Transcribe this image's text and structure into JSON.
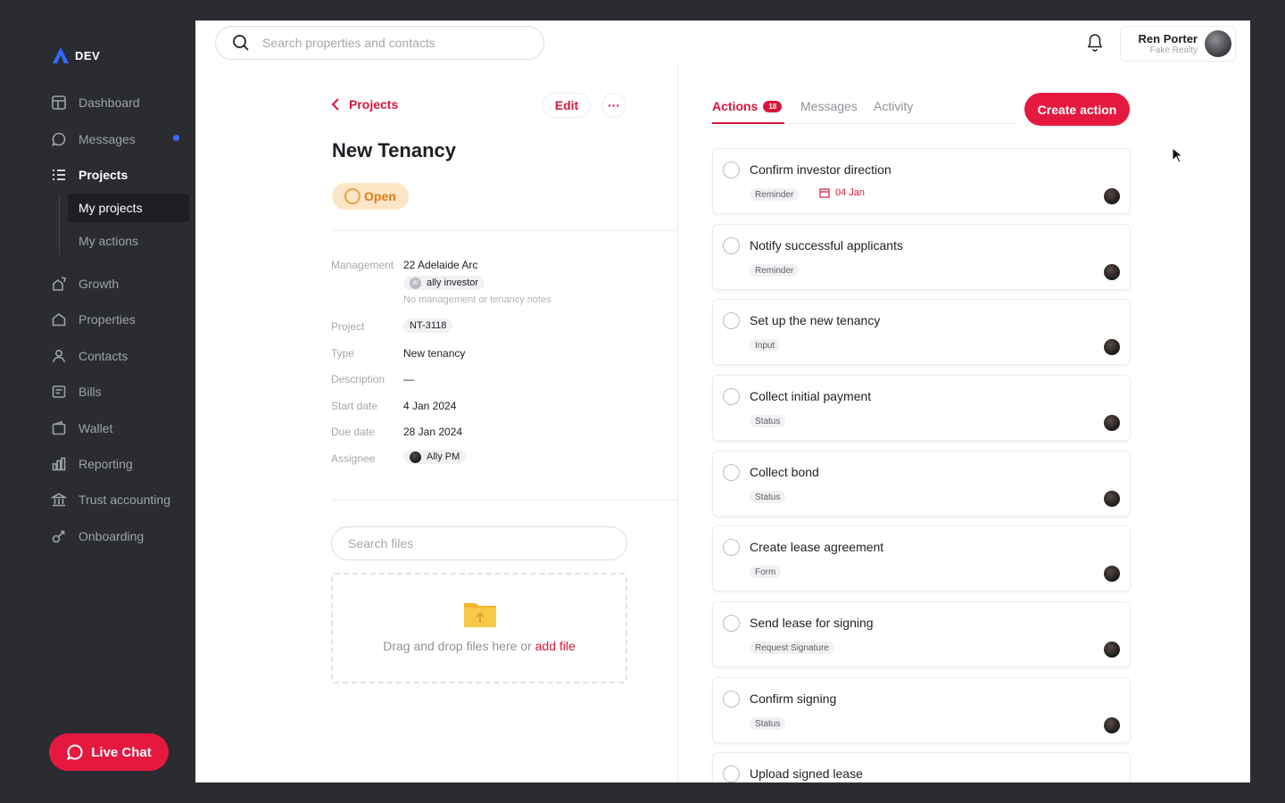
{
  "app": {
    "logo_text": "DEV"
  },
  "sidebar": {
    "items": [
      {
        "label": "Dashboard",
        "icon": "dashboard-icon"
      },
      {
        "label": "Messages",
        "icon": "chat-bubble-icon"
      },
      {
        "label": "Projects",
        "icon": "list-icon"
      },
      {
        "label": "Growth",
        "icon": "growth-icon"
      },
      {
        "label": "Properties",
        "icon": "home-icon"
      },
      {
        "label": "Contacts",
        "icon": "person-icon"
      },
      {
        "label": "Bills",
        "icon": "bill-icon"
      },
      {
        "label": "Wallet",
        "icon": "wallet-icon"
      },
      {
        "label": "Reporting",
        "icon": "bar-chart-icon"
      },
      {
        "label": "Trust accounting",
        "icon": "bank-icon"
      },
      {
        "label": "Onboarding",
        "icon": "onboarding-icon"
      }
    ],
    "subitems": [
      {
        "label": "My projects"
      },
      {
        "label": "My actions"
      }
    ],
    "live_chat": "Live Chat"
  },
  "topbar": {
    "search_placeholder": "Search properties and contacts",
    "user_name": "Ren Porter",
    "user_org": "Fake Realty"
  },
  "detail": {
    "back_label": "Projects",
    "edit_label": "Edit",
    "more_label": "···",
    "title": "New Tenancy",
    "status": "Open",
    "fields": {
      "management_label": "Management",
      "management_value": "22 Adelaide Arc",
      "investor_initials": "AI",
      "investor_chip": "ally investor",
      "notes": "No management or tenancy notes",
      "project_label": "Project",
      "project_value": "NT-3118",
      "type_label": "Type",
      "type_value": "New tenancy",
      "description_label": "Description",
      "description_value": "—",
      "start_label": "Start date",
      "start_value": "4 Jan 2024",
      "due_label": "Due date",
      "due_value": "28 Jan 2024",
      "assignee_label": "Assignee",
      "assignee_value": "Ally PM"
    },
    "file_search_placeholder": "Search files",
    "drop_text": "Drag and drop files here or ",
    "drop_link": "add file"
  },
  "actions_panel": {
    "tabs": [
      {
        "label": "Actions",
        "badge": "18"
      },
      {
        "label": "Messages"
      },
      {
        "label": "Activity"
      }
    ],
    "create_label": "Create action",
    "cards": [
      {
        "title": "Confirm investor direction",
        "tag": "Reminder",
        "date": "04 Jan"
      },
      {
        "title": "Notify successful applicants",
        "tag": "Reminder"
      },
      {
        "title": "Set up the new tenancy",
        "tag": "Input"
      },
      {
        "title": "Collect initial payment",
        "tag": "Status"
      },
      {
        "title": "Collect bond",
        "tag": "Status"
      },
      {
        "title": "Create lease agreement",
        "tag": "Form"
      },
      {
        "title": "Send lease for signing",
        "tag": "Request Signature"
      },
      {
        "title": "Confirm signing",
        "tag": "Status"
      },
      {
        "title": "Upload signed lease",
        "tag": ""
      }
    ]
  },
  "colors": {
    "accent": "#e5193f",
    "status_open_bg": "#fde6c6",
    "status_open_text": "#e07b12",
    "sidebar_bg": "#2a2c31"
  }
}
